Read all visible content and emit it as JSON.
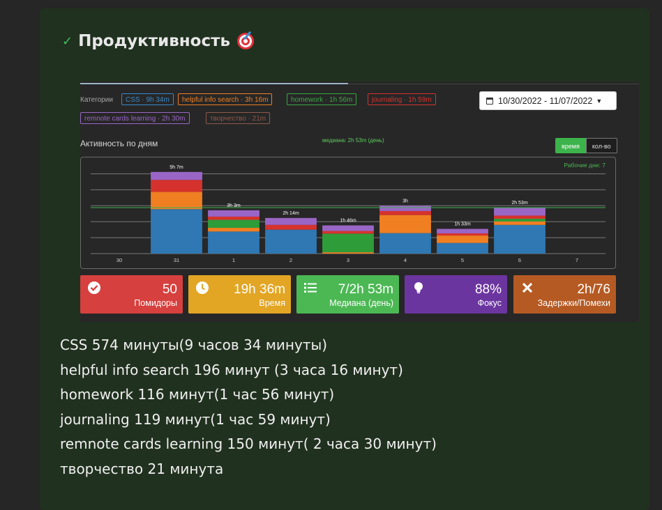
{
  "heading": {
    "title": "Продуктивность",
    "check_icon": "check-icon",
    "target_icon": "direct-hit-icon"
  },
  "widget": {
    "categories_label": "Категории",
    "tags": [
      {
        "label": "CSS · 9h 34m",
        "color": "#3a88c8"
      },
      {
        "label": "helpful info search · 3h 16m",
        "color": "#f07f22"
      },
      {
        "label": "homework · 1h 56m",
        "color": "#3aa843"
      },
      {
        "label": "journaling · 1h 59m",
        "color": "#d6322d"
      },
      {
        "label": "remnote cards learning · 2h 30m",
        "color": "#9a66c6"
      },
      {
        "label": "творчество · 21m",
        "color": "#8d5a4a"
      }
    ],
    "date_range": "10/30/2022 - 11/07/2022",
    "activity_title": "Активность по дням",
    "median_label": "медиана: 2h 53m (день)",
    "toggle": {
      "active": "время",
      "inactive": "кол-во"
    },
    "workdays_label": "Рабочие дни: 7"
  },
  "chart_data": {
    "type": "bar",
    "stacked": true,
    "categories": [
      "30",
      "31",
      "1",
      "2",
      "3",
      "4",
      "5",
      "6",
      "7"
    ],
    "totals_labels": [
      "",
      "5h 7m",
      "3h 3m",
      "2h 14m",
      "1h 46m",
      "3h",
      "1h 33m",
      "2h 53m",
      ""
    ],
    "ylim": [
      0,
      330
    ],
    "median_value": 173,
    "series": [
      {
        "name": "CSS",
        "color": "#2f78b4",
        "values": [
          0,
          167,
          83,
          90,
          0,
          77,
          40,
          108,
          0
        ]
      },
      {
        "name": "helpful info search",
        "color": "#f07f22",
        "values": [
          0,
          65,
          14,
          0,
          5,
          68,
          28,
          13,
          0
        ]
      },
      {
        "name": "homework",
        "color": "#2f9c3a",
        "values": [
          0,
          0,
          30,
          0,
          70,
          0,
          0,
          10,
          0
        ]
      },
      {
        "name": "journaling",
        "color": "#d6322d",
        "values": [
          0,
          45,
          12,
          18,
          10,
          15,
          8,
          12,
          0
        ]
      },
      {
        "name": "remnote cards learning",
        "color": "#9a66c6",
        "values": [
          0,
          30,
          24,
          26,
          21,
          20,
          17,
          30,
          0
        ]
      }
    ]
  },
  "stats": [
    {
      "value": "50",
      "label": "Помидоры",
      "color": "#d6403e",
      "icon": "check-circle-icon"
    },
    {
      "value": "19h 36m",
      "label": "Время",
      "color": "#e2a524",
      "icon": "clock-icon"
    },
    {
      "value": "7/2h 53m",
      "label": "Медиана (день)",
      "color": "#4cb854",
      "icon": "list-icon"
    },
    {
      "value": "88%",
      "label": "Фокус",
      "color": "#6b35a0",
      "icon": "lightbulb-icon"
    },
    {
      "value": "2h/76",
      "label": "Задержки/Помехи",
      "color": "#b55a23",
      "icon": "times-icon"
    }
  ],
  "notes": [
    "CSS 574 минуты(9 часов 34 минуты)",
    "helpful info search 196 минут (3 часа 16 минут)",
    "homework 116 минут(1 час 56 минут)",
    "journaling 119 минут(1 час 59 минут)",
    "remnote cards learning 150 минут( 2 часа 30 минут)",
    "творчество 21 минута"
  ]
}
